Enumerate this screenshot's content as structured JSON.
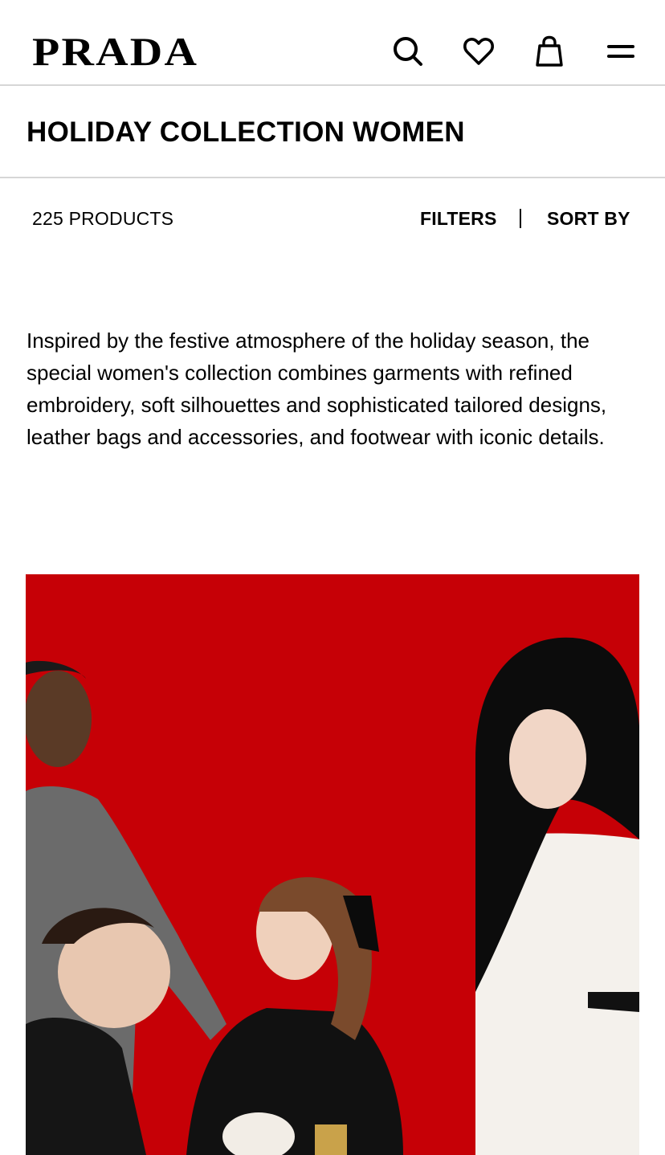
{
  "header": {
    "logo": "PRADA",
    "icons": [
      "search-icon",
      "heart-icon",
      "bag-icon",
      "menu-icon"
    ]
  },
  "page": {
    "title": "HOLIDAY COLLECTION WOMEN"
  },
  "toolbar": {
    "count": "225 PRODUCTS",
    "filters_label": "FILTERS",
    "sort_label": "SORT BY"
  },
  "description": "Inspired by the festive atmosphere of the holiday season, the special women's collection combines garments with refined embroidery, soft silhouettes and sophisticated tailored designs, leather bags and accessories, and footwear with iconic details.",
  "colors": {
    "hero_background": "#c60006",
    "divider": "#d6d6d6",
    "text": "#000000"
  }
}
